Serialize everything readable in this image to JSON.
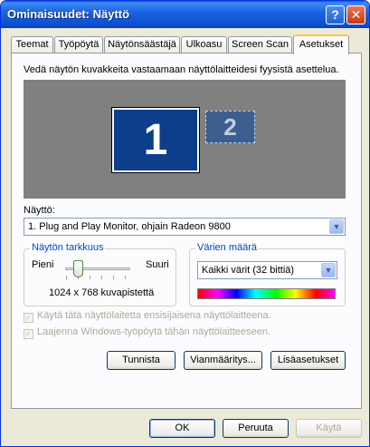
{
  "window": {
    "title": "Ominaisuudet: Näyttö",
    "help_label": "?",
    "close_label": "✕",
    "colors": {
      "title_bar": "#1d64e0",
      "close_button": "#c4380f",
      "active_tab_accent": "#ffc83c"
    }
  },
  "tabs": [
    {
      "label": "Teemat",
      "active": false
    },
    {
      "label": "Työpöytä",
      "active": false
    },
    {
      "label": "Näytönsäästäjä",
      "active": false
    },
    {
      "label": "Ulkoasu",
      "active": false
    },
    {
      "label": "Screen Scan",
      "active": false
    },
    {
      "label": "Asetukset",
      "active": true
    }
  ],
  "settings": {
    "instruction": "Vedä näytön kuvakkeita vastaamaan näyttölaitteidesi fyysistä asettelua.",
    "monitors": [
      {
        "label": "1",
        "primary": true
      },
      {
        "label": "2",
        "primary": false
      }
    ],
    "display_label": "Näyttö:",
    "display_value": "1. Plug and Play Monitor, ohjain Radeon 9800",
    "resolution": {
      "title": "Näytön tarkkuus",
      "min_label": "Pieni",
      "max_label": "Suuri",
      "value_text": "1024 x 768 kuvapistettä"
    },
    "color_quality": {
      "title": "Värien määrä",
      "value": "Kaikki värit (32 bittiä)"
    },
    "checkboxes": [
      {
        "label": "Käytä tätä näyttölaitetta ensisijaisena näyttölaitteena.",
        "checked": true,
        "enabled": false
      },
      {
        "label": "Laajenna Windows-työpöytä tähän näyttölaitteeseen.",
        "checked": true,
        "enabled": false
      }
    ],
    "buttons": {
      "identify": "Tunnista",
      "troubleshoot": "Vianmääritys...",
      "advanced": "Lisäasetukset"
    }
  },
  "dialog_buttons": {
    "ok": "OK",
    "cancel": "Peruuta",
    "apply": "Käytä"
  }
}
